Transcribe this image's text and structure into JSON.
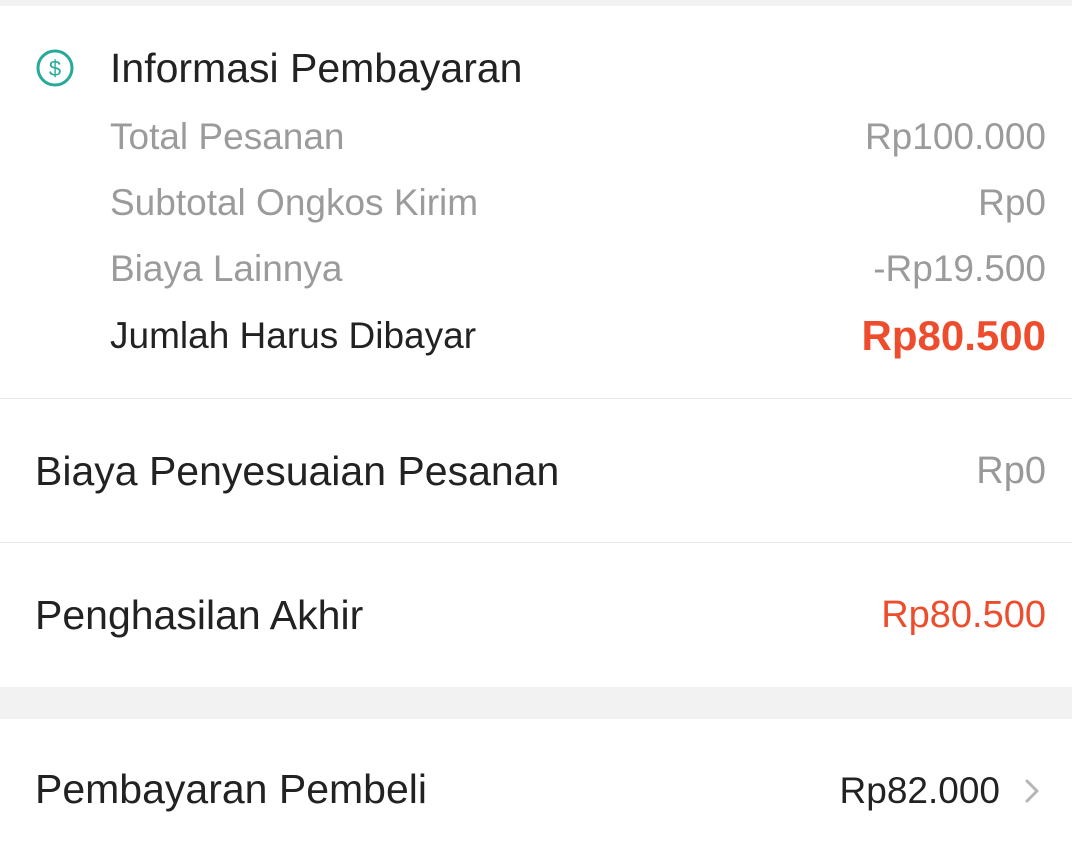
{
  "payment_info": {
    "title": "Informasi Pembayaran",
    "icon": "dollar-circle-icon",
    "rows": [
      {
        "label": "Total Pesanan",
        "value": "Rp100.000"
      },
      {
        "label": "Subtotal Ongkos Kirim",
        "value": "Rp0"
      },
      {
        "label": "Biaya Lainnya",
        "value": "-Rp19.500"
      }
    ],
    "total": {
      "label": "Jumlah Harus Dibayar",
      "value": "Rp80.500"
    }
  },
  "adjustment": {
    "label": "Biaya Penyesuaian Pesanan",
    "value": "Rp0"
  },
  "final_income": {
    "label": "Penghasilan Akhir",
    "value": "Rp80.500"
  },
  "buyer_payment": {
    "label": "Pembayaran Pembeli",
    "value": "Rp82.000",
    "icon": "chevron-right-icon"
  },
  "colors": {
    "accent_red": "#ee4d2d",
    "icon_teal": "#26aa99",
    "muted_text": "#9b9b9b"
  }
}
